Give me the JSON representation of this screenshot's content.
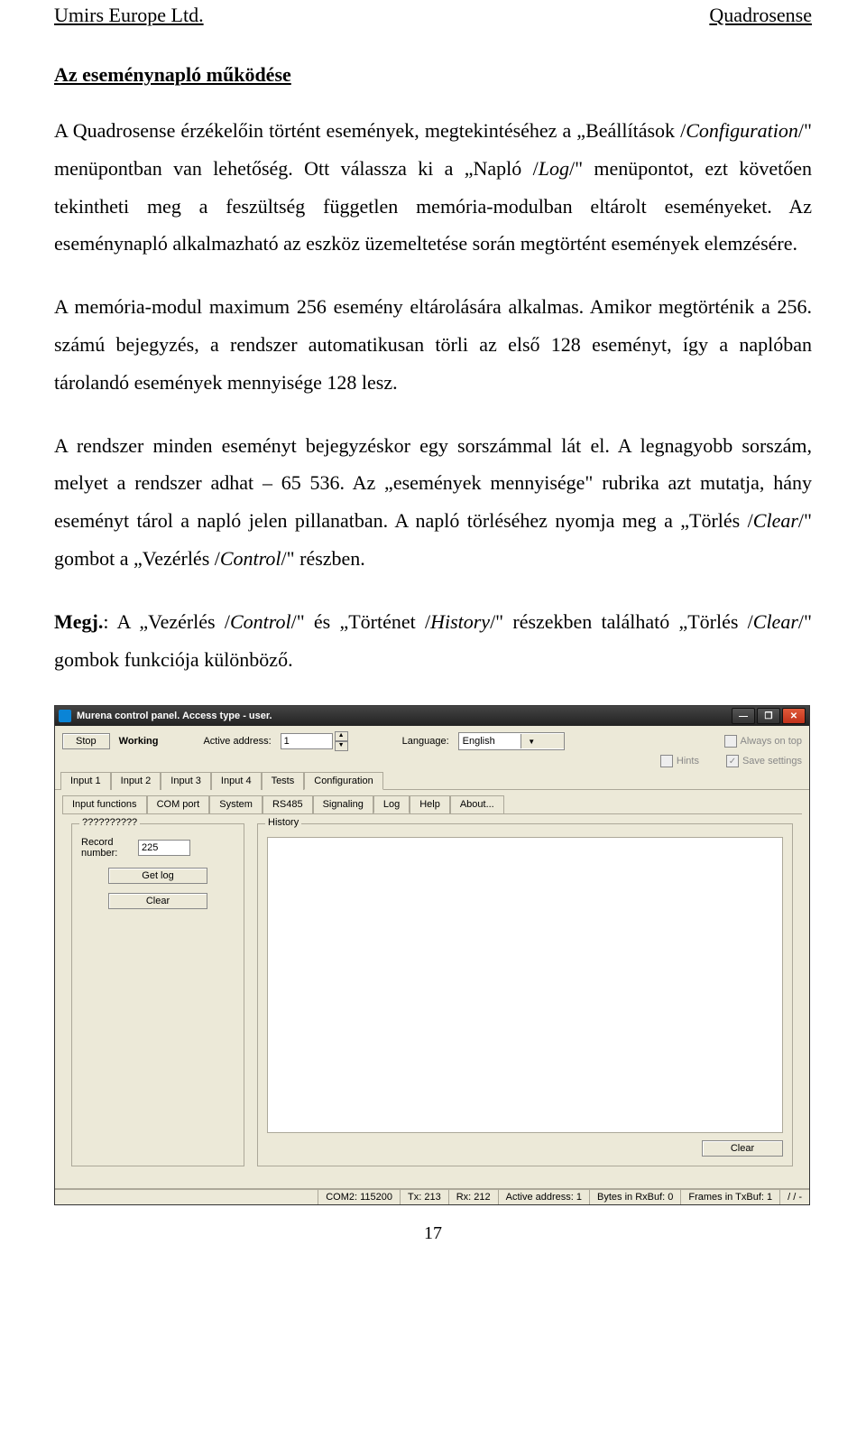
{
  "doc_header": {
    "left": "Umirs Europe Ltd.",
    "right": "Quadrosense"
  },
  "section_title": "Az eseménynapló működése",
  "paragraphs": {
    "p1_a": "A Quadrosense érzékelőin történt események, megtekintéséhez a „Beállítások /",
    "p1_b": "Configuration",
    "p1_c": "/\" menüpontban van lehetőség. Ott válassza ki a „Napló /",
    "p1_d": "Log",
    "p1_e": "/\" menüpontot, ezt követően tekintheti meg a feszültség független memória-modulban eltárolt eseményeket. Az eseménynapló alkalmazható az eszköz üzemeltetése során megtörtént események elemzésére.",
    "p2": "A memória-modul maximum 256 esemény eltárolására alkalmas. Amikor megtörténik a 256. számú bejegyzés, a rendszer automatikusan törli az első 128 eseményt, így a naplóban tárolandó események mennyisége 128 lesz.",
    "p3_a": "A rendszer minden eseményt bejegyzéskor egy sorszámmal lát el. A legnagyobb sorszám, melyet a rendszer adhat – 65 536. Az „események mennyisége\" rubrika azt mutatja, hány eseményt tárol a napló jelen pillanatban. A napló törléséhez nyomja meg a „Törlés /",
    "p3_b": "Clear",
    "p3_c": "/\" gombot a „Vezérlés /",
    "p3_d": "Control",
    "p3_e": "/\" részben.",
    "p4_a": "Megj.",
    "p4_b": ": A „Vezérlés /",
    "p4_c": "Control",
    "p4_d": "/\" és „Történet /",
    "p4_e": "History",
    "p4_f": "/\" részekben található „Törlés /",
    "p4_g": "Clear",
    "p4_h": "/\" gombok funkciója különböző."
  },
  "app": {
    "title": "Murena control panel. Access type - user.",
    "toolbar": {
      "stop": "Stop",
      "status": "Working",
      "active_addr_label": "Active address:",
      "active_addr_value": "1",
      "language_label": "Language:",
      "language_value": "English",
      "hints": "Hints",
      "always_on_top": "Always on top",
      "save_settings": "Save settings"
    },
    "tabs": [
      "Input 1",
      "Input 2",
      "Input 3",
      "Input 4",
      "Tests",
      "Configuration"
    ],
    "subtabs": [
      "Input functions",
      "COM port",
      "System",
      "RS485",
      "Signaling",
      "Log",
      "Help",
      "About..."
    ],
    "log": {
      "left_group_title": "??????????",
      "record_label": "Record number:",
      "record_value": "225",
      "getlog": "Get log",
      "clear": "Clear",
      "history_title": "History",
      "history_clear": "Clear"
    },
    "statusbar": {
      "s0": "",
      "s1": "COM2: 115200",
      "s2": "Tx: 213",
      "s3": "Rx: 212",
      "s4": "Active address: 1",
      "s5": "Bytes in RxBuf: 0",
      "s6": "Frames in TxBuf: 1",
      "s7": "/  /  -"
    }
  },
  "page_number": "17"
}
